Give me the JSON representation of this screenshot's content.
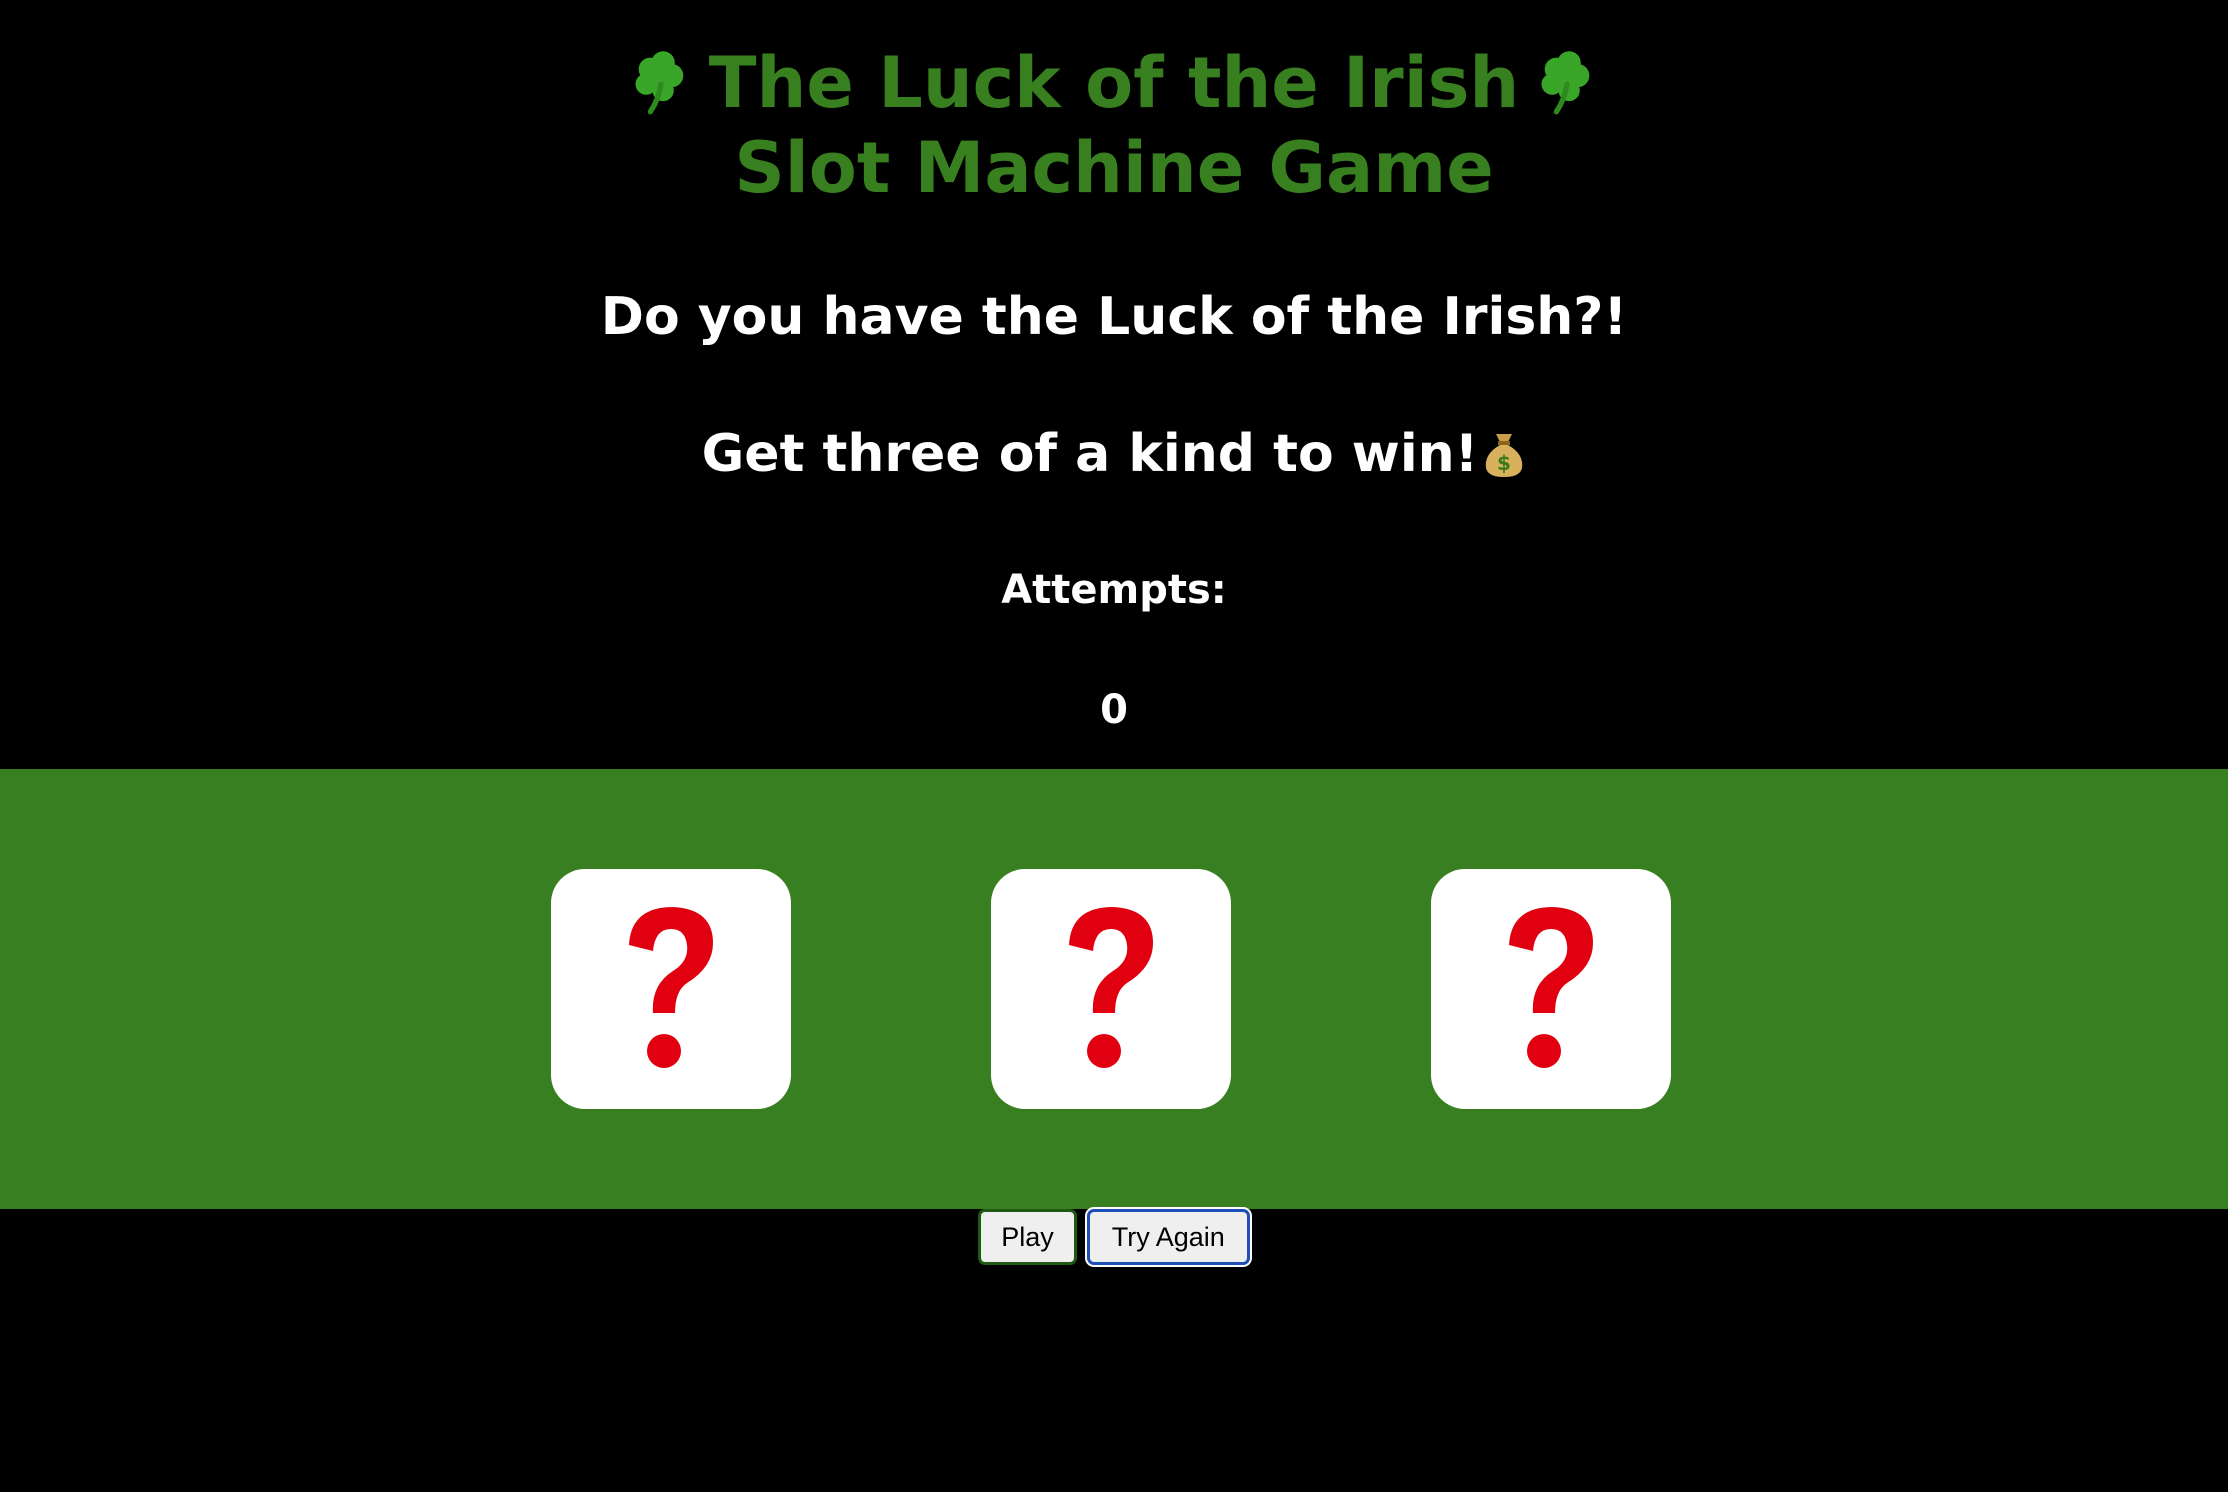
{
  "header": {
    "title_line1": "The Luck of the Irish",
    "title_line2": "Slot Machine Game"
  },
  "prompt": {
    "question": "Do you have the Luck of the Irish?!",
    "goal": "Get three of a kind to win!"
  },
  "attempts": {
    "label": "Attempts:",
    "value": "0"
  },
  "reels": [
    {
      "symbol": "question-mark-icon"
    },
    {
      "symbol": "question-mark-icon"
    },
    {
      "symbol": "question-mark-icon"
    }
  ],
  "controls": {
    "play_label": "Play",
    "try_again_label": "Try Again"
  },
  "icons": {
    "title_decoration": "shamrock-icon",
    "goal_decoration": "money-bag-icon"
  },
  "colors": {
    "background": "#000000",
    "title_green": "#38801f",
    "reel_band_green": "#387f21",
    "reel_face": "#ffffff",
    "question_red": "#e0000f",
    "text": "#ffffff"
  }
}
